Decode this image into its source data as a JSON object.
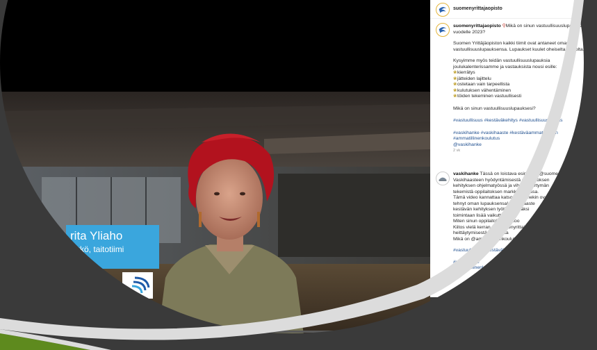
{
  "colors": {
    "frame_dark": "#3a3a3a",
    "frame_light": "#d9d9d9",
    "accent_green": "#5e8a1e",
    "lower_third_blue": "#3aa6dd",
    "hashtag_blue": "#1f4f8f"
  },
  "video": {
    "presenter_name": "rita Yliaho",
    "presenter_role": "llikkö, taitotiimi",
    "progress": 0.42
  },
  "post": {
    "header_username": "suomenyrittajaopisto",
    "caption_username": "suomenyrittajaopisto",
    "caption_line1": "Mikä on sinun vastuullisuuslupauksesi",
    "caption_line2": "vuodelle 2023?",
    "para1_line1": "Suomen Yrittäjäopiston kaikki tiimit ovat antaneet oman",
    "para1_line2": "vastuullisuuslupauksensa. Lupaukset kuulet oheiselta videolta.",
    "para2_line1": "Kysyimme myös teidän vastuullisuuslupauksia",
    "para2_line2": "joulukalenterissamme ja vastauksista nousi esille:",
    "list": [
      "kierrätys",
      "jätteiden lajittelu",
      "ostetaan vain tarpeellista",
      "kulutuksen vähentäminen",
      "töiden tekeminen vastuullisesti"
    ],
    "question": "Mikä on sinun vastuullisuuslupauksesi?",
    "hashtags1": "#vastuullisuus #kestäväkehitys #vastuullisuuslupaus",
    "hashtags2_line1": "#vaskihanke #vaskihaaste #kestäväammattilainen",
    "hashtags2_line2": "#ammatillinenkoulutus",
    "mention": "@vaskihanke",
    "time": "2 vk"
  },
  "comment": {
    "username": "vaskihanke",
    "lines": [
      "Tässä on loistava esimerkki @suomenyrittajaopisto",
      "Vaskihaasteen hyödyntämisestä oppilaitoksen",
      "kehityksen ohjelmatyössä ja vihreän siirtymän",
      "tekemistä oppilaitoksen markkinoinnissa.",
      "Tämä video kannattaa katsoa, sillä hekin ovat",
      "tehnyt oman lupauksensa!  Vaskihaaste",
      "kestävän kehityksen työtä näkyväksi",
      "toimintaan lisää vaikuttavuutta",
      "Miten sinun oppilaitoksesi aikoo",
      "Kiitos vielä kerran @suomenyrittajaopisto",
      "heittäytymisestä ja upeista",
      "Mikä on @ammatillinenkoulutus"
    ],
    "hashtag1": "#vastuullisuus #kestäväkehitys",
    "hashtag2": "#vaskihanke",
    "hashtag3": "#ammatillinenkoulutus"
  }
}
